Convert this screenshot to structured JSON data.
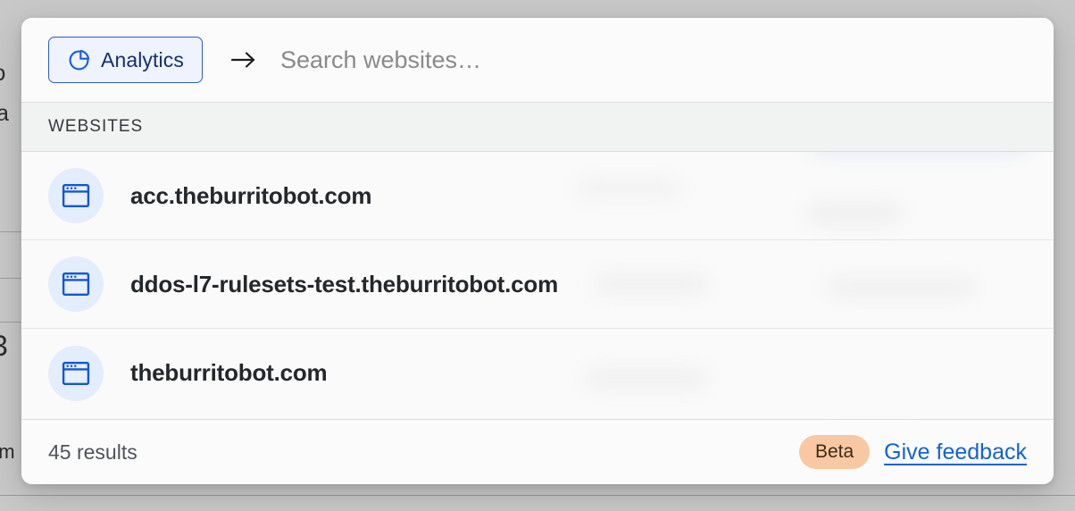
{
  "backdrop": {
    "fragments": [
      {
        "text": "ntio"
      },
      {
        "text": "a"
      },
      {
        "text": "3"
      },
      {
        "text": "am"
      }
    ]
  },
  "palette": {
    "scope_chip": {
      "label": "Analytics",
      "icon": "pie-chart-icon",
      "border_color": "#2c5cc5",
      "background_color": "#eef3fd",
      "text_color": "#16306b"
    },
    "go_arrow_icon": "arrow-right-icon",
    "search": {
      "value": "",
      "placeholder": "Search websites…"
    },
    "section": {
      "label": "WEBSITES"
    },
    "results": [
      {
        "icon": "browser-window-icon",
        "label": "acc.theburritobot.com"
      },
      {
        "icon": "browser-window-icon",
        "label": "ddos-l7-rulesets-test.theburritobot.com"
      },
      {
        "icon": "browser-window-icon",
        "label": "theburritobot.com"
      }
    ],
    "footer": {
      "count_label": "45 results",
      "badge_label": "Beta",
      "feedback_label": "Give feedback",
      "badge_color": "#f8c8a2",
      "link_color": "#1462d6"
    }
  }
}
